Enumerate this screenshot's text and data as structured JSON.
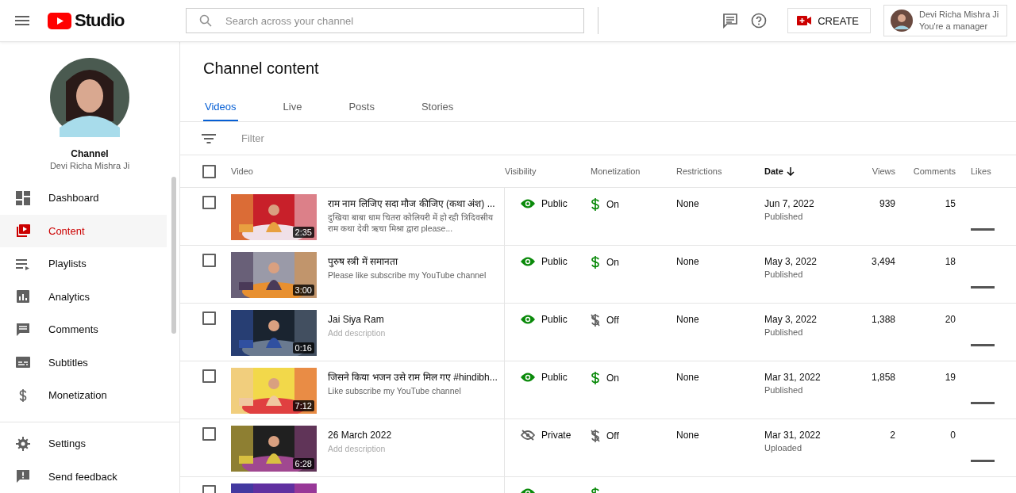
{
  "header": {
    "logo_text": "Studio",
    "search": {
      "placeholder": "Search across your channel"
    },
    "create_label": "CREATE",
    "account": {
      "name": "Devi Richa Mishra Ji",
      "role": "You're a manager"
    }
  },
  "sidebar": {
    "channel_label": "Channel",
    "channel_name": "Devi Richa Mishra Ji",
    "items": [
      {
        "label": "Dashboard",
        "selected": false
      },
      {
        "label": "Content",
        "selected": true
      },
      {
        "label": "Playlists",
        "selected": false
      },
      {
        "label": "Analytics",
        "selected": false
      },
      {
        "label": "Comments",
        "selected": false
      },
      {
        "label": "Subtitles",
        "selected": false
      },
      {
        "label": "Monetization",
        "selected": false
      }
    ],
    "footer_items": [
      {
        "label": "Settings"
      },
      {
        "label": "Send feedback"
      }
    ]
  },
  "page_title": "Channel content",
  "tabs": [
    {
      "label": "Videos",
      "selected": true
    },
    {
      "label": "Live",
      "selected": false
    },
    {
      "label": "Posts",
      "selected": false
    },
    {
      "label": "Stories",
      "selected": false
    }
  ],
  "filter": {
    "placeholder": "Filter"
  },
  "table": {
    "all_checked": false,
    "columns": [
      {
        "label": "Video",
        "sorted": false
      },
      {
        "label": "Visibility",
        "sorted": false
      },
      {
        "label": "Monetization",
        "sorted": false
      },
      {
        "label": "Restrictions",
        "sorted": false
      },
      {
        "label": "Date",
        "sorted": true
      },
      {
        "label": "Views",
        "sorted": false
      },
      {
        "label": "Comments",
        "sorted": false
      },
      {
        "label": "Likes",
        "sorted": false
      }
    ],
    "rows": [
      {
        "checked": false,
        "title": "राम नाम लिजिए सदा मौज कीजिए (कथा अंश) ...",
        "description": "दुखिया बाबा धाम चितरा कोलियरी में हो रही त्रिदिवसीय राम कथा देवी ऋचा मिश्रा द्वारा please...",
        "description_placeholder": false,
        "duration": "2:35",
        "visibility": "Public",
        "public": true,
        "monetization": "On",
        "monetization_on": true,
        "restrictions": "None",
        "date": "Jun 7, 2022",
        "status": "Published",
        "views": "939",
        "comments": "15"
      },
      {
        "checked": false,
        "title": "पुरुष स्त्री में समानता",
        "description": "Please like subscribe my YouTube channel",
        "description_placeholder": false,
        "duration": "3:00",
        "visibility": "Public",
        "public": true,
        "monetization": "On",
        "monetization_on": true,
        "restrictions": "None",
        "date": "May 3, 2022",
        "status": "Published",
        "views": "3,494",
        "comments": "18"
      },
      {
        "checked": false,
        "title": "Jai Siya Ram",
        "description": "Add description",
        "description_placeholder": true,
        "duration": "0:16",
        "visibility": "Public",
        "public": true,
        "monetization": "Off",
        "monetization_on": false,
        "restrictions": "None",
        "date": "May 3, 2022",
        "status": "Published",
        "views": "1,388",
        "comments": "20"
      },
      {
        "checked": false,
        "title": "जिसने किया भजन उसे राम मिल गए #hindibh...",
        "description": "Like subscribe my YouTube channel",
        "description_placeholder": false,
        "duration": "7:12",
        "visibility": "Public",
        "public": true,
        "monetization": "On",
        "monetization_on": true,
        "restrictions": "None",
        "date": "Mar 31, 2022",
        "status": "Published",
        "views": "1,858",
        "comments": "19"
      },
      {
        "checked": false,
        "title": "26 March 2022",
        "description": "Add description",
        "description_placeholder": true,
        "duration": "6:28",
        "visibility": "Private",
        "public": false,
        "monetization": "Off",
        "monetization_on": false,
        "restrictions": "None",
        "date": "Mar 31, 2022",
        "status": "Uploaded",
        "views": "2",
        "comments": "0"
      },
      {
        "checked": false,
        "public": true,
        "monetization_on": true
      }
    ]
  }
}
